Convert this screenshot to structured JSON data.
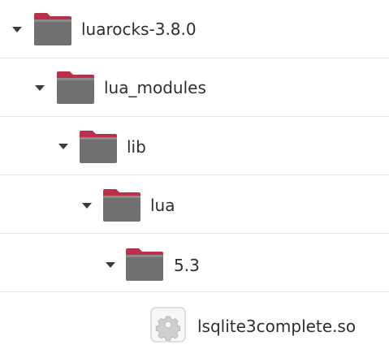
{
  "tree": {
    "items": [
      {
        "label": "luarocks-3.8.0",
        "type": "folder",
        "expanded": true,
        "icon": "folder-icon"
      },
      {
        "label": "lua_modules",
        "type": "folder",
        "expanded": true,
        "icon": "folder-icon"
      },
      {
        "label": "lib",
        "type": "folder",
        "expanded": true,
        "icon": "folder-icon"
      },
      {
        "label": "lua",
        "type": "folder",
        "expanded": true,
        "icon": "folder-icon"
      },
      {
        "label": "5.3",
        "type": "folder",
        "expanded": true,
        "icon": "folder-icon"
      },
      {
        "label": "lsqlite3complete.so",
        "type": "file",
        "icon": "shared-library-icon"
      }
    ]
  },
  "colors": {
    "folder_body": "#6e6e6e",
    "folder_tab": "#b8304a",
    "text": "#2e2e2e",
    "separator": "#e4e4e4"
  }
}
